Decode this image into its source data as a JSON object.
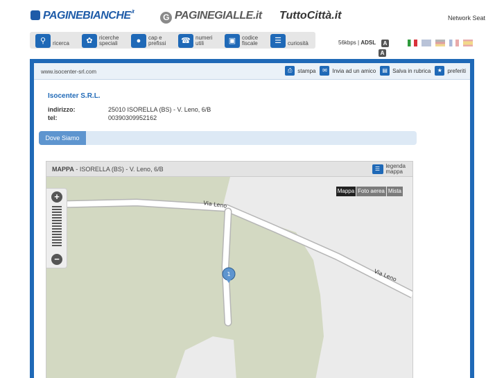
{
  "brands": {
    "paginebianche": "PAGINEBIANCHE",
    "paginebianche_tld": ".it",
    "paginegialle": "PAGINEGIALLE",
    "paginegialle_tld": ".it",
    "tuttocitta": "TuttoCittà",
    "tuttocitta_tld": ".it",
    "network": "Network Seat"
  },
  "nav": {
    "items": [
      {
        "label": "ricerca",
        "icon": "search-icon"
      },
      {
        "label": "ricerche speciali",
        "icon": "puzzle-icon"
      },
      {
        "label": "cap e prefissi",
        "icon": "globe-icon"
      },
      {
        "label": "numeri utili",
        "icon": "phone-icon"
      },
      {
        "label": "codice fiscale",
        "icon": "card-icon"
      },
      {
        "label": "curiosità",
        "icon": "book-icon"
      }
    ]
  },
  "connection": {
    "slow": "56kbps",
    "fast": "ADSL",
    "font_up": "A",
    "font_down": "A"
  },
  "languages": [
    "it",
    "en",
    "de",
    "fr",
    "es"
  ],
  "colors": {
    "brand_blue": "#1f69b7",
    "tab_blue": "#5e95cf",
    "map_green": "#d3d9c2"
  },
  "toolbar": {
    "url": "www.isocenter-srl.com",
    "stampa": "stampa",
    "invia": "Invia ad un amico",
    "salva": "Salva in rubrica",
    "preferiti": "preferiti"
  },
  "company": {
    "name": "Isocenter S.R.L.",
    "address_label": "indirizzo:",
    "address": "25010 ISORELLA (BS) - V. Leno, 6/B",
    "tel_label": "tel:",
    "tel": "00390309952162"
  },
  "tabs": {
    "dove_siamo": "Dove Siamo"
  },
  "map": {
    "heading": "MAPPA",
    "location": " - ISORELLA (BS) - V. Leno, 6/B",
    "legend_line1": "legenda",
    "legend_line2": "mappa",
    "types": [
      "Mappa",
      "Foto aerea",
      "Mista"
    ],
    "road_name_1": "Via Leno",
    "road_name_2": "Via Leno",
    "marker": "1",
    "zoom_in": "+",
    "zoom_out": "−"
  }
}
